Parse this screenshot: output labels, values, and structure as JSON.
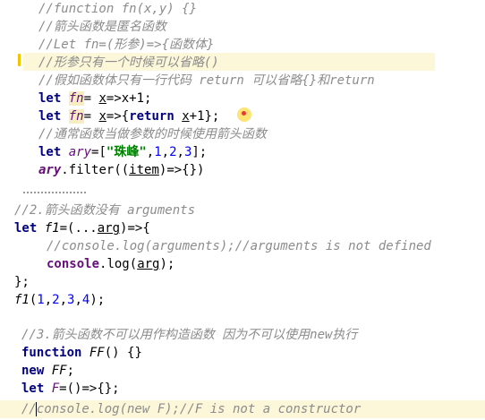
{
  "block1": {
    "l1": "//function fn(x,y) {}",
    "l2": "//箭头函数是匿名函数",
    "l3": "//Let fn=(形参)=>{函数体}",
    "l4": "//形参只有一个时候可以省略()",
    "l5": "//假如函数体只有一行代码 return 可以省略{}和return",
    "l6": {
      "kw": "let",
      "name": "fn",
      "eq": "= ",
      "param": "x",
      "rest": "=>x+1;"
    },
    "l7": {
      "kw": "let",
      "name": "fn",
      "eq": "= ",
      "param": "x",
      "mid": "=>{",
      "ret": "return",
      "sp": " ",
      "x": "x",
      "tail": "+1};"
    },
    "l8": "//通常函数当做参数的时候使用箭头函数",
    "l9": {
      "kw": "let",
      "name": "ary",
      "eq": "=[",
      "str": "\"珠峰\"",
      "c1": ",",
      "n1": "1",
      "c2": ",",
      "n2": "2",
      "c3": ",",
      "n3": "3",
      "end": "];"
    },
    "l10": {
      "obj": "ary",
      "dot": ".",
      "method": "filter",
      "open": "((",
      "param": "item",
      "close": ")=>{})"
    }
  },
  "block2": {
    "l1": "//2.箭头函数没有 arguments",
    "l2": {
      "kw": "let",
      "name": "f1",
      "eq": "=(...",
      "param": "arg",
      "rest": ")=>{"
    },
    "l3": "//console.log(arguments);//arguments is not defined",
    "l4": {
      "obj": "console",
      "dot": ".",
      "method": "log",
      "open": "(",
      "param": "arg",
      "close": ");"
    },
    "l5": "};",
    "l6": {
      "name": "f1",
      "open": "(",
      "n1": "1",
      "c1": ",",
      "n2": "2",
      "c2": ",",
      "n3": "3",
      "c3": ",",
      "n4": "4",
      "close": ");"
    }
  },
  "block3": {
    "l1": "//3.箭头函数不可以用作构造函数 因为不可以使用new执行",
    "l2": {
      "kw": "function",
      "name": "FF",
      "rest": "() {}"
    },
    "l3": {
      "kw": "new",
      "name": "FF",
      "rest": ";"
    },
    "l4": {
      "kw": "let",
      "name": "F",
      "rest": "=()=>{};"
    },
    "l5": "//console.log(new F);//F is not a constructor"
  },
  "colors": {
    "comment": "#8c8c8c",
    "keyword": "#000080",
    "string": "#008000",
    "number": "#0000ff",
    "highlight": "#fbf7d8"
  }
}
